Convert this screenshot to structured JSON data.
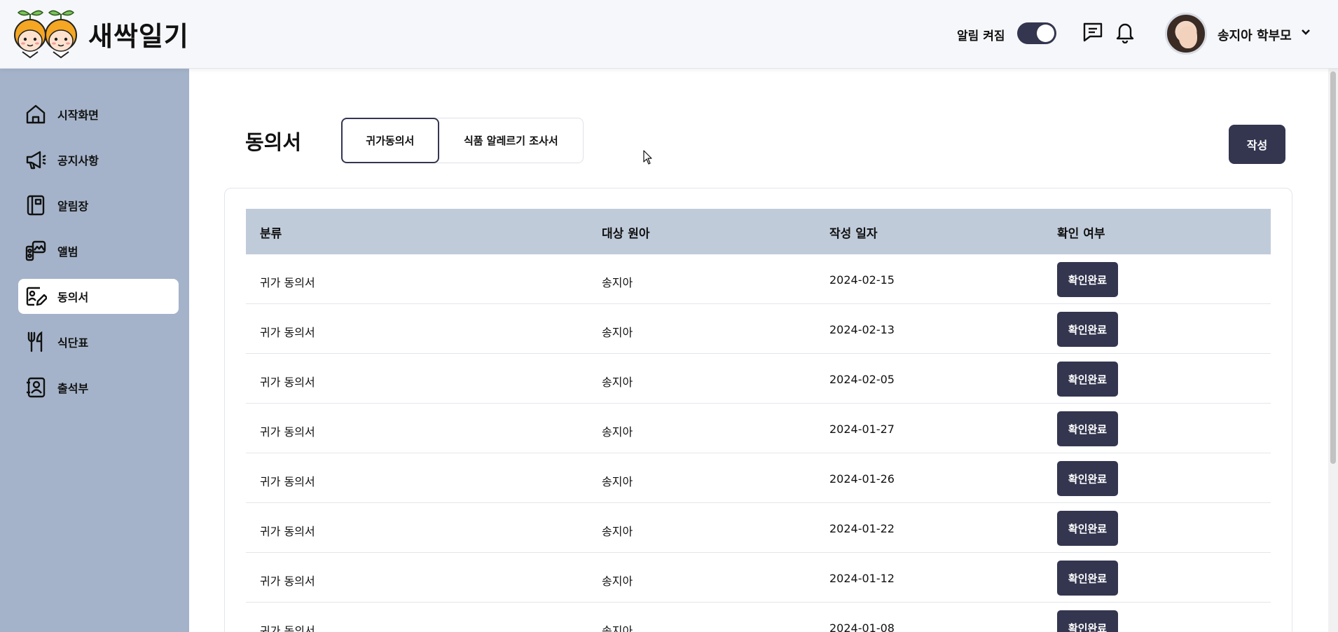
{
  "app": {
    "name": "새싹일기"
  },
  "header": {
    "notification_label": "알림 켜짐",
    "notification_on": true,
    "user_name": "송지아 학부모"
  },
  "sidebar": {
    "items": [
      {
        "label": "시작화면",
        "icon": "home-icon",
        "active": false
      },
      {
        "label": "공지사항",
        "icon": "megaphone-icon",
        "active": false
      },
      {
        "label": "알림장",
        "icon": "notebook-icon",
        "active": false
      },
      {
        "label": "앨범",
        "icon": "album-icon",
        "active": false
      },
      {
        "label": "동의서",
        "icon": "consent-icon",
        "active": true
      },
      {
        "label": "식단표",
        "icon": "utensils-icon",
        "active": false
      },
      {
        "label": "출석부",
        "icon": "contact-book-icon",
        "active": false
      }
    ]
  },
  "main": {
    "title": "동의서",
    "tabs": [
      {
        "label": "귀가동의서",
        "active": true
      },
      {
        "label": "식품 알레르기 조사서",
        "active": false
      }
    ],
    "write_button": "작성",
    "table": {
      "headers": [
        "분류",
        "대상 원아",
        "작성 일자",
        "확인 여부"
      ],
      "rows": [
        {
          "category": "귀가 동의서",
          "child": "송지아",
          "date": "2024-02-15",
          "status": "확인완료"
        },
        {
          "category": "귀가 동의서",
          "child": "송지아",
          "date": "2024-02-13",
          "status": "확인완료"
        },
        {
          "category": "귀가 동의서",
          "child": "송지아",
          "date": "2024-02-05",
          "status": "확인완료"
        },
        {
          "category": "귀가 동의서",
          "child": "송지아",
          "date": "2024-01-27",
          "status": "확인완료"
        },
        {
          "category": "귀가 동의서",
          "child": "송지아",
          "date": "2024-01-26",
          "status": "확인완료"
        },
        {
          "category": "귀가 동의서",
          "child": "송지아",
          "date": "2024-01-22",
          "status": "확인완료"
        },
        {
          "category": "귀가 동의서",
          "child": "송지아",
          "date": "2024-01-12",
          "status": "확인완료"
        },
        {
          "category": "귀가 동의서",
          "child": "송지아",
          "date": "2024-01-08",
          "status": "확인완료"
        }
      ]
    }
  },
  "colors": {
    "sidebar_bg": "#a4b3c9",
    "table_header_bg": "#c0cbda",
    "primary_dark": "#343650",
    "header_bg": "#f6f7fa"
  }
}
